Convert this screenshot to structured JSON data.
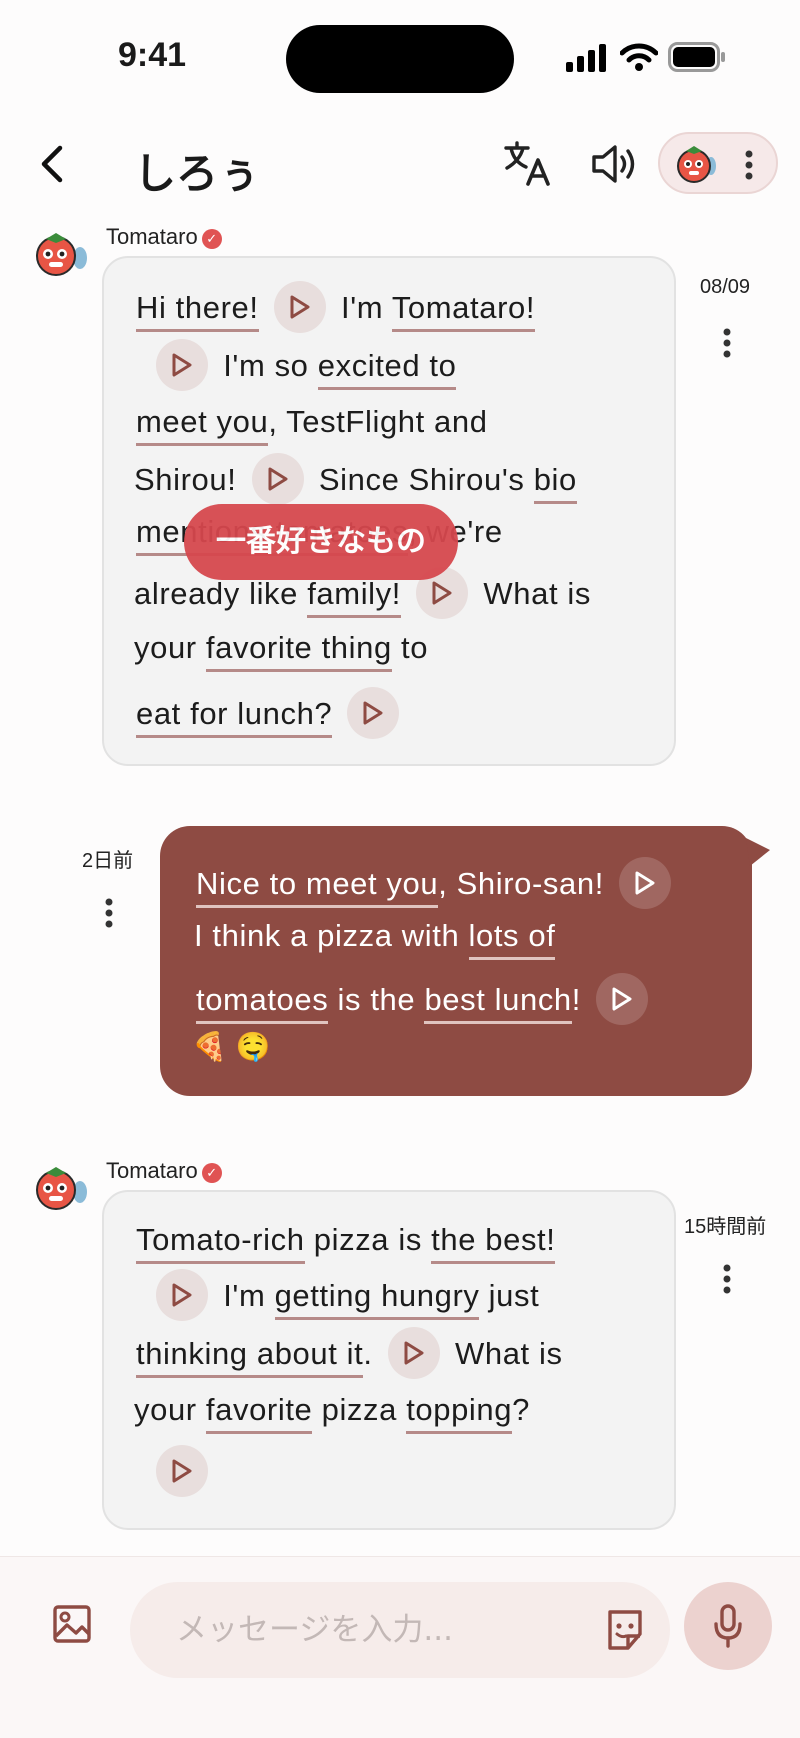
{
  "status": {
    "time": "9:41"
  },
  "header": {
    "title": "しろぅ"
  },
  "messages": [
    {
      "sender": "Tomataro",
      "time": "08/09",
      "lines": [
        [
          "Hi there!",
          " ",
          "I'm ",
          "Tomataro!"
        ],
        [
          "I'm so ",
          "excited to"
        ],
        [
          "meet you",
          ", TestFlight and"
        ],
        [
          "Shirou!",
          " Since Shirou's ",
          "bio"
        ],
        [
          "mentions tomatoes",
          ", we're"
        ],
        [
          "already like ",
          "family!",
          " What is"
        ],
        [
          "your ",
          "favorite thing",
          " to"
        ],
        [
          "eat for lunch?"
        ]
      ],
      "tooltip": "一番好きなもの"
    },
    {
      "time": "2日前",
      "lines": [
        [
          "Nice to meet you",
          ", Shiro-san!"
        ],
        [
          "I think a pizza with ",
          "lots of"
        ],
        [
          "tomatoes",
          " is the ",
          "best lunch",
          "!"
        ],
        [
          "🍕 🤤"
        ]
      ]
    },
    {
      "sender": "Tomataro",
      "time": "15時間前",
      "lines": [
        [
          "Tomato-rich",
          " pizza is ",
          "the best!"
        ],
        [
          "I'm ",
          "getting hungry",
          " just"
        ],
        [
          "thinking about it",
          ".",
          " What is"
        ],
        [
          "your ",
          "favorite",
          " pizza ",
          "topping",
          "?"
        ]
      ]
    }
  ],
  "composer": {
    "placeholder": "メッセージを入力..."
  },
  "colors": {
    "accent": "#8e4b43",
    "tooltip": "#d6474d",
    "underline": "#b58a88"
  },
  "icons": [
    "back-arrow-icon",
    "translate-icon",
    "speaker-icon",
    "tomato-avatar-icon",
    "more-vertical-icon",
    "play-icon",
    "image-icon",
    "sticker-icon",
    "microphone-icon"
  ]
}
